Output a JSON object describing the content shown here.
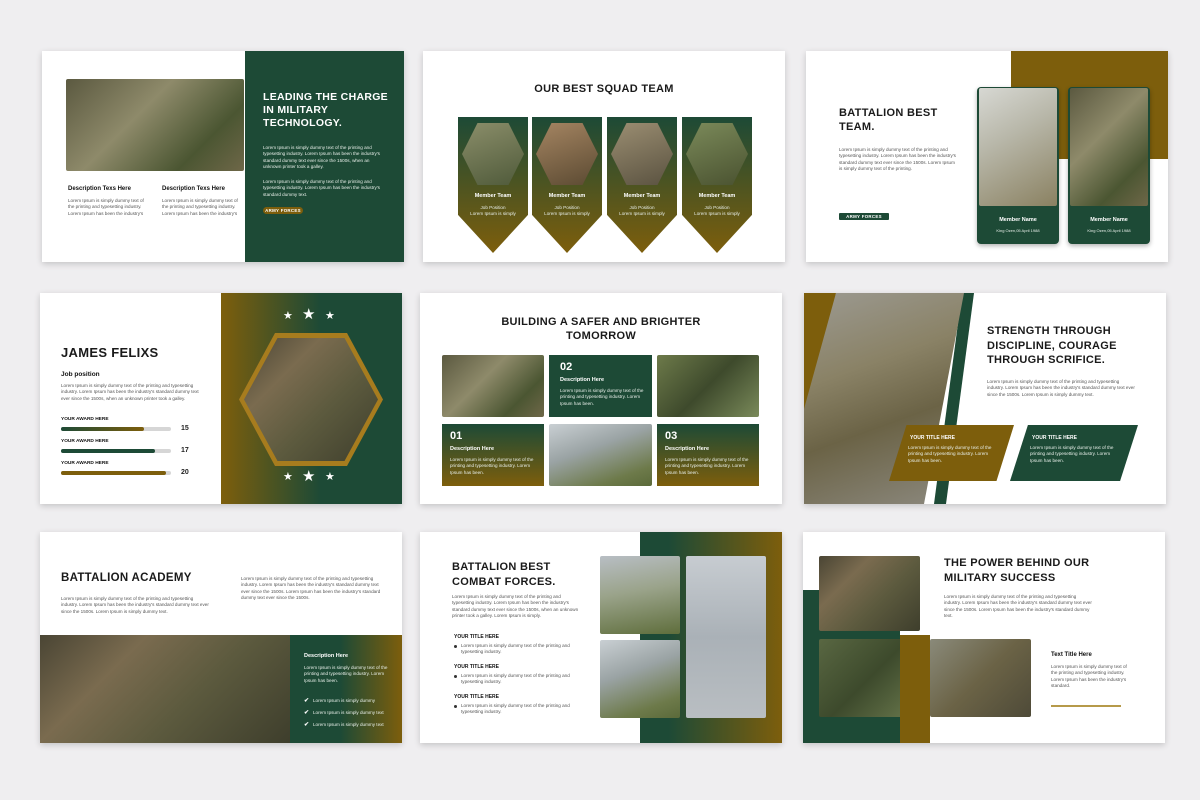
{
  "s1": {
    "title": "LEADING THE CHARGE IN MILITARY TECHNOLOGY.",
    "para1": "Lorem Ipsum is simply dummy text of the printing and typesetting industry. Lorem Ipsum has been the industry's standard dummy text ever since the 1500s, when an unknown printer took a galley.",
    "para2": "Lorem Ipsum is simply dummy text of the printing and typesetting industry. Lorem Ipsum has been the industry's standard dummy text.",
    "desc1_title": "Description Texs Here",
    "desc2_title": "Description Texs Here",
    "desc_text": "Lorem Ipsum is simply dummy text of the printing and typesetting industry. Lorem Ipsum has been the industry's",
    "button": "ARMY FORCES"
  },
  "s2": {
    "title": "OUR BEST SQUAD TEAM",
    "members": [
      {
        "name": "Member Team",
        "role": "Job Position",
        "text": "Lorem Ipsum is simply"
      },
      {
        "name": "Member Team",
        "role": "Job Position",
        "text": "Lorem Ipsum is simply"
      },
      {
        "name": "Member Team",
        "role": "Job Position",
        "text": "Lorem Ipsum is simply"
      },
      {
        "name": "Member Team",
        "role": "Job Position",
        "text": "Lorem Ipsum is simply"
      }
    ]
  },
  "s3": {
    "title": "BATTALION BEST TEAM.",
    "para": "Lorem Ipsum is simply dummy text of the printing and typesetting industry. Lorem Ipsum has been the industry's standard dummy text ever since the 1500s. Lorem Ipsum is simply dummy text of the printing.",
    "button": "ARMY FORCES",
    "cards": [
      {
        "name": "Member Name",
        "sub": "King Ozen,05 April 1988"
      },
      {
        "name": "Member Name",
        "sub": "King Ozen,05 April 1988"
      }
    ]
  },
  "s4": {
    "name": "JAMES FELIXS",
    "position": "Job position",
    "para": "Lorem Ipsum is simply dummy text of the printing and typesetting industry. Lorem Ipsum has been the industry's standard dummy text ever since the 1500s, when an unknown printer took a galley.",
    "awards": [
      {
        "label": "YOUR AWARD HERE",
        "value": "15",
        "level": 0.75
      },
      {
        "label": "YOUR AWARD HERE",
        "value": "17",
        "level": 0.85
      },
      {
        "label": "YOUR AWARD HERE",
        "value": "20",
        "level": 0.95
      }
    ]
  },
  "s5": {
    "title": "BUILDING A SAFER AND BRIGHTER TOMORROW",
    "items": [
      {
        "num": "02",
        "title": "Description Here",
        "text": "Lorem Ipsum is simply dummy text of the printing and typesetting industry. Lorem Ipsum has been."
      },
      {
        "num": "01",
        "title": "Description Here",
        "text": "Lorem Ipsum is simply dummy text of the printing and typesetting industry. Lorem Ipsum has been."
      },
      {
        "num": "03",
        "title": "Description Here",
        "text": "Lorem Ipsum is simply dummy text of the printing and typesetting industry. Lorem Ipsum has been."
      }
    ]
  },
  "s6": {
    "title": "STRENGTH THROUGH DISCIPLINE, COURAGE THROUGH SCRIFICE.",
    "para": "Lorem Ipsum is simply dummy text of the printing and typesetting industry. Lorem Ipsum has been the industry's standard dummy text ever since the 1500s. Lorem Ipsum is simply dummy text.",
    "box1_title": "YOUR TITLE HERE",
    "box1_text": "Lorem Ipsum is simply dummy text of the printing and typesetting industry. Lorem Ipsum has been.",
    "box2_title": "YOUR TITLE HERE",
    "box2_text": "Lorem Ipsum is simply dummy text of the printing and typesetting industry. Lorem Ipsum has been."
  },
  "s7": {
    "title": "BATTALION ACADEMY",
    "para_right": "Lorem Ipsum is simply dummy text of the printing and typesetting industry. Lorem Ipsum has been the industry's standard dummy text ever since the 1500s. Lorem Ipsum has been the industry's standard dummy text ever since the 1500s.",
    "para_left": "Lorem Ipsum is simply dummy text of the printing and typesetting industry. Lorem Ipsum has been the industry's standard dummy text ever since the 1500s. Lorem Ipsum is simply dummy text.",
    "desc_title": "Description Here",
    "desc_text": "Lorem Ipsum is simply dummy text of the printing and typesetting industry. Lorem Ipsum has been.",
    "checks": [
      "Lorem Ipsum is simply dummy",
      "Lorem Ipsum is simply dummy text",
      "Lorem Ipsum is simply dummy text"
    ]
  },
  "s8": {
    "title": "BATTALION BEST COMBAT FORCES.",
    "para": "Lorem Ipsum is simply dummy text of the printing and typesetting industry. Lorem Ipsum has been the industry's standard dummy text ever since the 1500s, when an unknown printer took a galley. Lorem Ipsum is simply.",
    "items": [
      {
        "title": "YOUR TITLE HERE",
        "text": "Lorem Ipsum is simply dummy text of the printing and typesetting industry."
      },
      {
        "title": "YOUR TITLE HERE",
        "text": "Lorem Ipsum is simply dummy text of the printing and typesetting industry."
      },
      {
        "title": "YOUR TITLE HERE",
        "text": "Lorem Ipsum is simply dummy text of the printing and typesetting industry."
      }
    ]
  },
  "s9": {
    "title": "THE POWER BEHIND OUR MILITARY SUCCESS",
    "para": "Lorem Ipsum is simply dummy text of the printing and typesetting industry. Lorem Ipsum has been the industry's standard dummy text ever since the 1500s. Lorem Ipsum has been the industry's standard dummy text.",
    "sub_title": "Text Title Here",
    "sub_text": "Lorem Ipsum is simply dummy text of the printing and typesetting industry. Lorem Ipsum has been the industry's standard."
  }
}
